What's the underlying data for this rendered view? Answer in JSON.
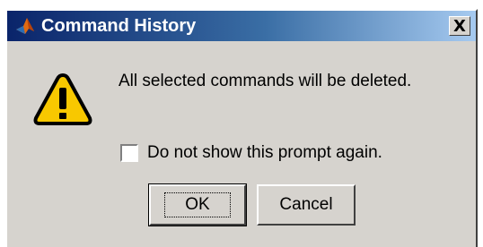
{
  "window": {
    "title": "Command History",
    "app_icon": "matlab-logo-icon",
    "close_label": "X"
  },
  "dialog": {
    "icon": "warning-icon",
    "message": "All selected commands will be deleted.",
    "checkbox_label": "Do not show this prompt again.",
    "checkbox_checked": false,
    "ok_label": "OK",
    "cancel_label": "Cancel"
  },
  "colors": {
    "titlebar_start": "#0a246a",
    "titlebar_end": "#a6caf0",
    "dialog_bg": "#d6d3ce",
    "warning_fill": "#f8c800"
  }
}
